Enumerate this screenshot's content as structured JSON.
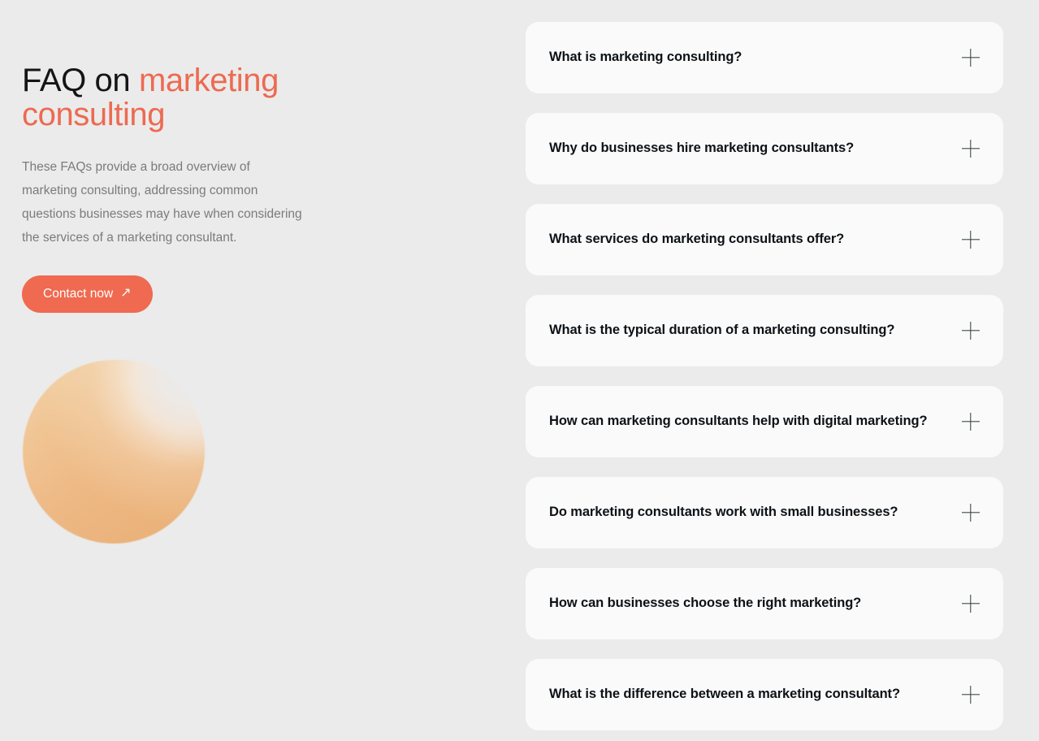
{
  "theme": {
    "background": "#ebebeb",
    "accent": "#ed6a51",
    "card_background": "#fafafa",
    "heading_color": "#151515",
    "paragraph_color": "#7b7b7b",
    "question_color": "#0d1216",
    "icon_color": "#2c3a33"
  },
  "intro": {
    "headline_lead": "FAQ on ",
    "headline_accent": "marketing consulting",
    "paragraph": "These FAQs provide a broad overview of marketing consulting, addressing common questions businesses may have when considering the services of a marketing consultant.",
    "cta_label": "Contact now",
    "cta_arrow": "↗"
  },
  "faq": {
    "expand_icon": "plus-icon",
    "items": [
      {
        "question": "What is marketing consulting?"
      },
      {
        "question": "Why do businesses hire marketing consultants?"
      },
      {
        "question": "What services do marketing consultants offer?"
      },
      {
        "question": "What is the typical duration of a marketing consulting?"
      },
      {
        "question": "How can marketing consultants help with digital marketing?"
      },
      {
        "question": "Do marketing consultants work with small businesses?"
      },
      {
        "question": "How can businesses choose the right marketing?"
      },
      {
        "question": "What is the difference between a marketing consultant?"
      }
    ]
  }
}
